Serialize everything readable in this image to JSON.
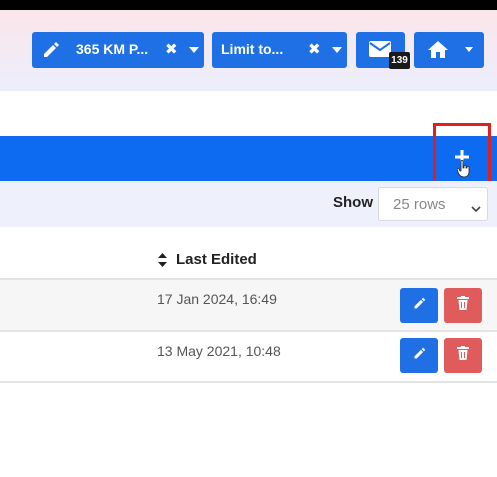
{
  "header": {
    "filter_chips": [
      {
        "label": "365 KM P..."
      },
      {
        "label": "Limit to..."
      }
    ],
    "messages": {
      "badge_count": "139"
    }
  },
  "toolbar": {
    "show_label": "Show",
    "rows_value": "25 rows"
  },
  "table": {
    "columns": [
      {
        "label": "Last Edited"
      }
    ],
    "rows": [
      {
        "last_edited": "17 Jan 2024, 16:49"
      },
      {
        "last_edited": "13 May 2021, 10:48"
      }
    ]
  },
  "colors": {
    "primary": "#1f6fe5",
    "bar": "#0d6bf2",
    "danger": "#e05c5c",
    "highlight": "#e02020"
  },
  "icons": [
    "pencil-icon",
    "times-icon",
    "caret-down-icon",
    "envelope-icon",
    "home-icon",
    "plus-icon",
    "sort-icon",
    "trash-icon",
    "hand-cursor-icon"
  ]
}
